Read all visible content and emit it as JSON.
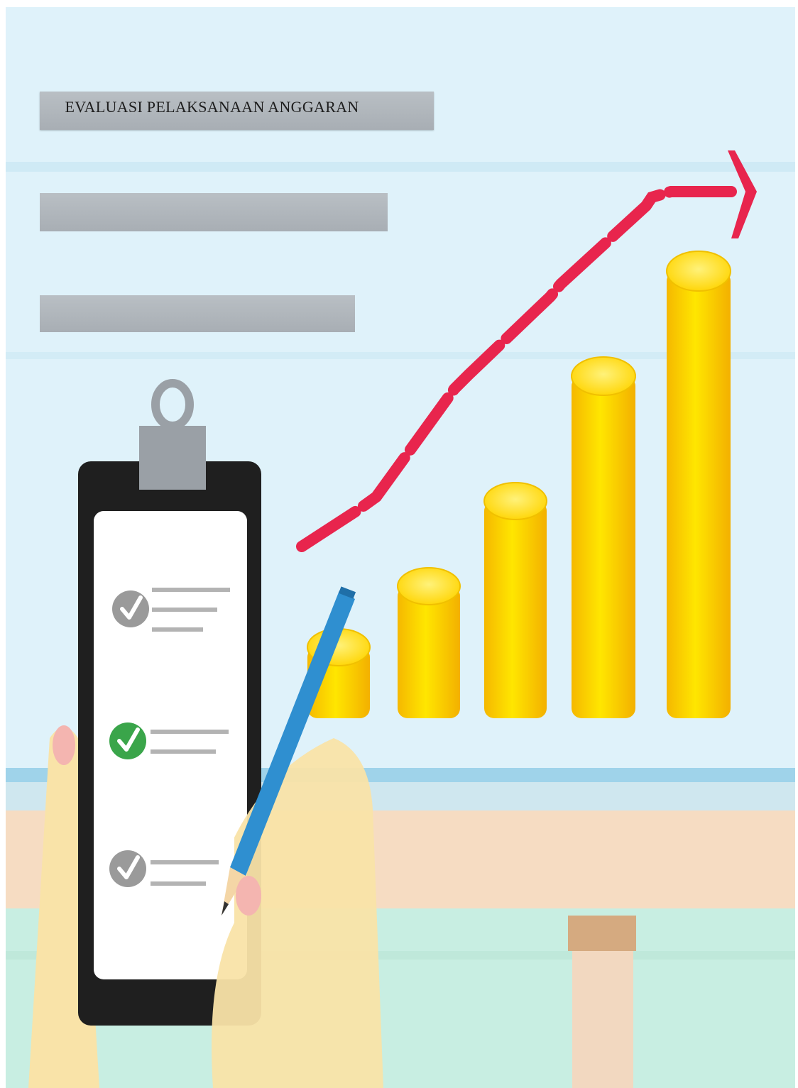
{
  "header": {
    "title": "EVALUASI PELAKSANAAN ANGGARAN"
  },
  "illustration": {
    "checklist_items": [
      {
        "status": "checked",
        "color": "#9a9a9a"
      },
      {
        "status": "checked",
        "color": "#3aa54a"
      },
      {
        "status": "checked",
        "color": "#9a9a9a"
      }
    ],
    "coin_stacks": 5,
    "trend": "rising",
    "colors": {
      "sky": "#dff3fb",
      "coin": "#ffd400",
      "arrow": "#e8254d",
      "pencil": "#2f8fd0",
      "clipboard": "#1f1f1f"
    }
  }
}
